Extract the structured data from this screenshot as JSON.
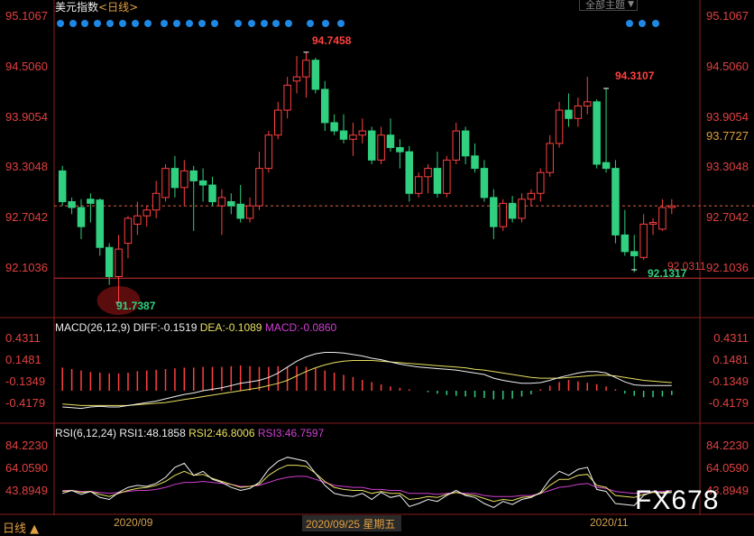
{
  "header": {
    "title": "美元指数",
    "period": "<日线>",
    "theme_button": "全部主题",
    "theme_arrow": "▼"
  },
  "price_axis_left": [
    "95.1067",
    "94.5060",
    "93.9054",
    "93.3048",
    "92.7042",
    "92.1036"
  ],
  "price_axis_right": [
    "95.1067",
    "94.5060",
    "93.9054",
    "93.7727",
    "93.3048",
    "92.7042",
    "92.1036"
  ],
  "annotations": {
    "high": "94.7458",
    "high2": "94.3107",
    "low": "91.7387",
    "low2": "92.1317",
    "support": "92.0311"
  },
  "macd": {
    "header_name": "MACD(26,12,9)",
    "diff": "DIFF:-0.1519",
    "dea": "DEA:-0.1089",
    "macd": "MACD:-0.0860",
    "axis": [
      "0.4311",
      "0.1481",
      "-0.1349",
      "-0.4179"
    ]
  },
  "rsi": {
    "header_name": "RSI(6,12,24)",
    "rsi1": "RSI1:48.1858",
    "rsi2": "RSI2:46.8006",
    "rsi3": "RSI3:46.7597",
    "axis": [
      "84.2230",
      "64.0590",
      "43.8949"
    ]
  },
  "footer": {
    "period_button": "日线 ▲",
    "date1": "2020/09",
    "date_selected": "2020/09/25 星期五",
    "date2": "2020/11"
  },
  "watermark": "FX678",
  "colors": {
    "up": "#ff4040",
    "down": "#30d080",
    "accent_blue": "#1e88e5",
    "support_line": "#d03030"
  },
  "chart_data": {
    "type": "candlestick",
    "series_name": "美元指数 日线",
    "ylim": [
      91.6,
      95.2
    ],
    "candles": [
      [
        93.32,
        93.38,
        92.9,
        92.95
      ],
      [
        92.95,
        93.0,
        92.8,
        92.88
      ],
      [
        92.88,
        92.98,
        92.5,
        92.65
      ],
      [
        92.98,
        93.05,
        92.7,
        92.93
      ],
      [
        92.97,
        92.99,
        92.3,
        92.4
      ],
      [
        92.4,
        92.45,
        91.95,
        92.05
      ],
      [
        92.05,
        92.55,
        91.74,
        92.38
      ],
      [
        92.45,
        92.78,
        92.27,
        92.75
      ],
      [
        92.68,
        92.95,
        92.55,
        92.78
      ],
      [
        92.78,
        92.9,
        92.65,
        92.85
      ],
      [
        92.85,
        93.2,
        92.75,
        93.05
      ],
      [
        93.0,
        93.4,
        92.95,
        93.35
      ],
      [
        93.35,
        93.5,
        93.0,
        93.12
      ],
      [
        93.12,
        93.45,
        92.9,
        93.32
      ],
      [
        93.32,
        93.38,
        92.6,
        93.2
      ],
      [
        93.2,
        93.35,
        92.95,
        93.15
      ],
      [
        93.15,
        93.25,
        92.9,
        92.95
      ],
      [
        92.9,
        93.1,
        92.55,
        93.0
      ],
      [
        92.95,
        93.05,
        92.8,
        92.9
      ],
      [
        92.92,
        93.15,
        92.7,
        92.75
      ],
      [
        92.75,
        93.0,
        92.7,
        92.9
      ],
      [
        92.9,
        93.55,
        92.85,
        93.35
      ],
      [
        93.35,
        93.8,
        93.3,
        93.75
      ],
      [
        93.75,
        94.15,
        93.7,
        94.05
      ],
      [
        94.05,
        94.45,
        93.95,
        94.35
      ],
      [
        94.4,
        94.7,
        94.25,
        94.45
      ],
      [
        94.45,
        94.75,
        94.2,
        94.65
      ],
      [
        94.65,
        94.68,
        94.25,
        94.3
      ],
      [
        94.3,
        94.4,
        93.8,
        93.9
      ],
      [
        93.9,
        94.0,
        93.75,
        93.8
      ],
      [
        93.8,
        94.0,
        93.65,
        93.7
      ],
      [
        93.7,
        93.9,
        93.5,
        93.75
      ],
      [
        93.75,
        93.95,
        93.65,
        93.8
      ],
      [
        93.8,
        93.85,
        93.4,
        93.45
      ],
      [
        93.45,
        93.85,
        93.4,
        93.75
      ],
      [
        93.75,
        93.95,
        93.55,
        93.6
      ],
      [
        93.6,
        93.7,
        93.35,
        93.55
      ],
      [
        93.55,
        93.62,
        92.95,
        93.05
      ],
      [
        93.05,
        93.3,
        93.0,
        93.25
      ],
      [
        93.25,
        93.4,
        93.05,
        93.35
      ],
      [
        93.35,
        93.55,
        93.0,
        93.05
      ],
      [
        93.05,
        93.5,
        93.0,
        93.45
      ],
      [
        93.45,
        93.9,
        93.4,
        93.8
      ],
      [
        93.8,
        93.85,
        93.4,
        93.5
      ],
      [
        93.5,
        93.65,
        93.3,
        93.35
      ],
      [
        93.35,
        93.45,
        92.95,
        93.0
      ],
      [
        93.0,
        93.1,
        92.5,
        92.65
      ],
      [
        92.65,
        92.98,
        92.6,
        92.93
      ],
      [
        92.93,
        93.02,
        92.7,
        92.75
      ],
      [
        92.75,
        93.05,
        92.7,
        92.98
      ],
      [
        92.98,
        93.1,
        92.9,
        93.05
      ],
      [
        93.05,
        93.35,
        92.95,
        93.3
      ],
      [
        93.3,
        93.75,
        93.25,
        93.65
      ],
      [
        93.65,
        94.15,
        93.6,
        94.05
      ],
      [
        94.05,
        94.25,
        93.85,
        93.95
      ],
      [
        93.95,
        94.2,
        93.85,
        94.1
      ],
      [
        94.1,
        94.45,
        94.0,
        94.15
      ],
      [
        94.15,
        94.18,
        93.35,
        93.4
      ],
      [
        93.42,
        94.31,
        93.3,
        93.35
      ],
      [
        93.35,
        93.45,
        92.45,
        92.55
      ],
      [
        92.55,
        92.85,
        92.3,
        92.35
      ],
      [
        92.35,
        92.55,
        92.1,
        92.3
      ],
      [
        92.28,
        92.8,
        92.25,
        92.68
      ],
      [
        92.68,
        92.75,
        92.55,
        92.7
      ],
      [
        92.62,
        92.98,
        92.6,
        92.88
      ],
      [
        92.88,
        92.98,
        92.8,
        92.9
      ]
    ],
    "support_level": 92.0311,
    "dashed_level": 92.9,
    "macd_ylim": [
      -0.55,
      0.55
    ],
    "diff_values": [
      -0.44,
      -0.45,
      -0.46,
      -0.44,
      -0.43,
      -0.44,
      -0.44,
      -0.42,
      -0.4,
      -0.38,
      -0.36,
      -0.33,
      -0.3,
      -0.27,
      -0.25,
      -0.22,
      -0.2,
      -0.18,
      -0.15,
      -0.12,
      -0.1,
      -0.08,
      -0.04,
      0.02,
      0.1,
      0.18,
      0.24,
      0.28,
      0.3,
      0.3,
      0.29,
      0.27,
      0.25,
      0.22,
      0.2,
      0.17,
      0.14,
      0.12,
      0.1,
      0.09,
      0.08,
      0.07,
      0.06,
      0.04,
      0.02,
      0.0,
      -0.05,
      -0.08,
      -0.1,
      -0.12,
      -0.12,
      -0.11,
      -0.08,
      -0.04,
      -0.01,
      0.02,
      0.04,
      0.04,
      0.02,
      -0.04,
      -0.1,
      -0.14,
      -0.15,
      -0.15,
      -0.15,
      -0.15
    ],
    "dea_values": [
      -0.4,
      -0.41,
      -0.42,
      -0.42,
      -0.42,
      -0.42,
      -0.42,
      -0.42,
      -0.41,
      -0.4,
      -0.39,
      -0.38,
      -0.36,
      -0.34,
      -0.32,
      -0.3,
      -0.28,
      -0.26,
      -0.24,
      -0.22,
      -0.2,
      -0.18,
      -0.15,
      -0.12,
      -0.08,
      -0.02,
      0.04,
      0.09,
      0.13,
      0.16,
      0.18,
      0.19,
      0.19,
      0.19,
      0.18,
      0.17,
      0.16,
      0.15,
      0.14,
      0.13,
      0.12,
      0.11,
      0.1,
      0.09,
      0.07,
      0.06,
      0.04,
      0.02,
      0.0,
      -0.02,
      -0.04,
      -0.05,
      -0.05,
      -0.05,
      -0.04,
      -0.03,
      -0.02,
      -0.01,
      -0.01,
      -0.02,
      -0.04,
      -0.06,
      -0.08,
      -0.09,
      -0.1,
      -0.11
    ],
    "macd_bars": [
      0.32,
      0.3,
      0.28,
      0.26,
      0.25,
      0.24,
      0.24,
      0.25,
      0.27,
      0.28,
      0.29,
      0.3,
      0.31,
      0.32,
      0.32,
      0.33,
      0.33,
      0.33,
      0.34,
      0.35,
      0.34,
      0.33,
      0.33,
      0.34,
      0.33,
      0.34,
      0.33,
      0.31,
      0.28,
      0.25,
      0.22,
      0.19,
      0.15,
      0.12,
      0.09,
      0.06,
      0.04,
      0.02,
      0.0,
      -0.02,
      -0.04,
      -0.06,
      -0.07,
      -0.08,
      -0.09,
      -0.1,
      -0.12,
      -0.12,
      -0.11,
      -0.08,
      -0.05,
      0.02,
      0.07,
      0.12,
      0.15,
      0.13,
      0.11,
      0.09,
      0.06,
      0.02,
      -0.04,
      -0.07,
      -0.09,
      -0.09,
      -0.08,
      -0.06
    ],
    "rsi_ylim": [
      25,
      95
    ],
    "rsi1_values": [
      44,
      47,
      43,
      46,
      40,
      38,
      45,
      50,
      52,
      51,
      54,
      60,
      70,
      74,
      62,
      66,
      58,
      55,
      50,
      47,
      49,
      55,
      68,
      76,
      80,
      78,
      76,
      64,
      52,
      44,
      42,
      41,
      44,
      38,
      45,
      40,
      42,
      31,
      34,
      38,
      36,
      42,
      47,
      42,
      40,
      34,
      30,
      36,
      33,
      38,
      40,
      45,
      58,
      66,
      62,
      68,
      70,
      48,
      46,
      34,
      33,
      32,
      42,
      46,
      44,
      45
    ],
    "rsi2_values": [
      46,
      47,
      45,
      46,
      43,
      41,
      44,
      47,
      49,
      50,
      52,
      56,
      62,
      66,
      62,
      63,
      59,
      56,
      53,
      50,
      51,
      53,
      62,
      68,
      72,
      72,
      71,
      64,
      56,
      50,
      48,
      47,
      47,
      44,
      46,
      44,
      44,
      38,
      39,
      41,
      40,
      43,
      45,
      43,
      42,
      39,
      36,
      38,
      37,
      40,
      41,
      44,
      52,
      58,
      58,
      62,
      63,
      52,
      50,
      42,
      41,
      40,
      43,
      45,
      45,
      46
    ],
    "rsi3_values": [
      47,
      47,
      46,
      46,
      45,
      44,
      45,
      46,
      47,
      47,
      48,
      50,
      53,
      55,
      55,
      56,
      55,
      54,
      53,
      51,
      51,
      52,
      55,
      58,
      60,
      61,
      61,
      58,
      55,
      52,
      51,
      50,
      50,
      48,
      48,
      47,
      47,
      44,
      44,
      44,
      43,
      44,
      45,
      44,
      44,
      42,
      41,
      41,
      41,
      42,
      42,
      44,
      47,
      50,
      51,
      53,
      54,
      50,
      49,
      46,
      45,
      44,
      45,
      46,
      46,
      47
    ]
  }
}
